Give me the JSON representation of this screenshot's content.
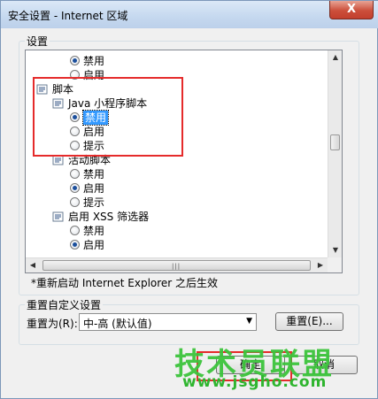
{
  "window": {
    "title": "安全设置 - Internet 区域",
    "close_glyph": "X"
  },
  "settings_group": {
    "legend": "设置"
  },
  "tree": {
    "items": [
      {
        "kind": "radio",
        "label": "禁用",
        "checked": true
      },
      {
        "kind": "radio",
        "label": "启用",
        "checked": false
      },
      {
        "kind": "folder",
        "label": "脚本"
      },
      {
        "kind": "folder",
        "label": "Java 小程序脚本"
      },
      {
        "kind": "radio",
        "label": "禁用",
        "checked": true,
        "selected": true
      },
      {
        "kind": "radio",
        "label": "启用",
        "checked": false
      },
      {
        "kind": "radio",
        "label": "提示",
        "checked": false
      },
      {
        "kind": "folder",
        "label": "活动脚本"
      },
      {
        "kind": "radio",
        "label": "禁用",
        "checked": false
      },
      {
        "kind": "radio",
        "label": "启用",
        "checked": true
      },
      {
        "kind": "radio",
        "label": "提示",
        "checked": false
      },
      {
        "kind": "folder",
        "label": "启用 XSS 筛选器"
      },
      {
        "kind": "radio",
        "label": "禁用",
        "checked": false
      },
      {
        "kind": "radio",
        "label": "启用",
        "checked": true
      }
    ]
  },
  "restart_note": "*重新启动 Internet Explorer 之后生效",
  "reset_group": {
    "legend": "重置自定义设置",
    "reset_to_label": "重置为(R):",
    "level_value": "中-高 (默认值)",
    "reset_button": "重置(E)..."
  },
  "footer": {
    "ok_button": "确定",
    "cancel_button": "取消"
  },
  "watermark": {
    "text": "技术员联盟",
    "url": "www.jsgho.com"
  },
  "colors": {
    "highlight_box": "#e52b2b",
    "watermark": "#3cc43c",
    "selection": "#3399ff"
  }
}
